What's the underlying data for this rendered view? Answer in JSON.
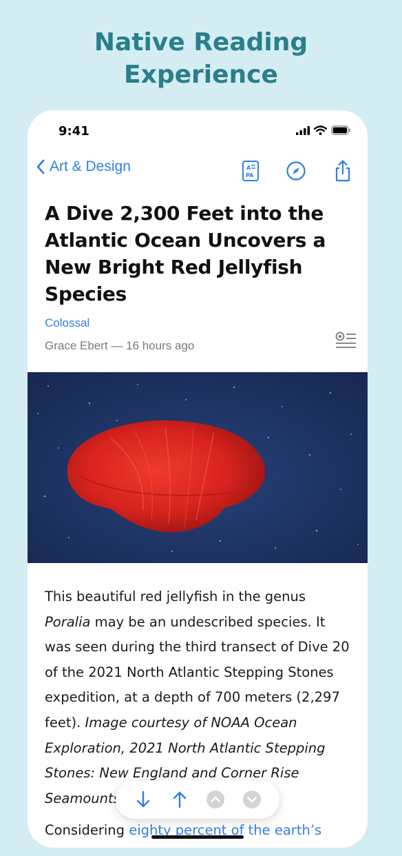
{
  "promo": {
    "title_line1": "Native Reading",
    "title_line2": "Experience"
  },
  "status_bar": {
    "time": "9:41"
  },
  "nav": {
    "back_label": "Art & Design",
    "icons": [
      "reader-mode-icon",
      "compass-icon",
      "share-icon"
    ]
  },
  "article": {
    "title": "A Dive 2,300 Feet into the Atlantic Ocean Uncovers a New Bright Red Jellyfish Species",
    "source": "Colossal",
    "byline": "Grace Ebert — 16 hours ago",
    "body": {
      "p1_a": "This beautiful red jellyfish in the genus ",
      "p1_genus": "Poralia",
      "p1_b": " may be an undescribed species. It was seen during the third transect of Dive 20 of the 2021 North Atlantic Stepping Stones expedition, at a depth of 700 meters (2,297 feet). ",
      "p1_credit": "Image courtesy of NOAA Ocean Exploration, 2021 North Atlantic Stepping Stones: New England and Corner Rise Seamounts",
      "p2_a": "Considering ",
      "p2_link": "eighty percent of the earth’s"
    }
  },
  "find_bar": {
    "buttons": [
      "arrow-down-icon",
      "arrow-up-icon",
      "chevron-up-circle-icon",
      "chevron-down-circle-icon"
    ]
  },
  "colors": {
    "background": "#d3edf2",
    "promo_title": "#2b7e8c",
    "accent": "#2f7fe0",
    "image_bg": "#1f3566",
    "jellyfish": "#d8231e"
  }
}
